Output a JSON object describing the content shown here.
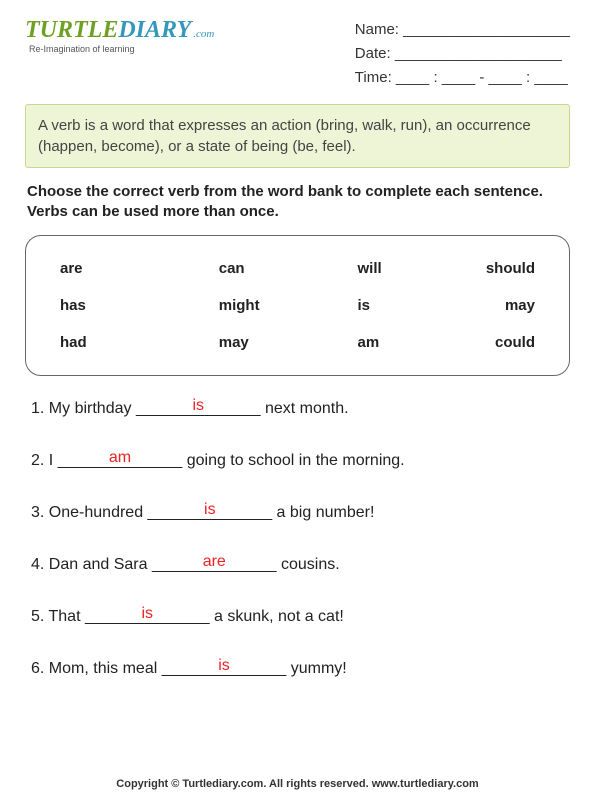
{
  "logo": {
    "part1": "TURTLE",
    "part2": "DIARY",
    "suffix": ".com",
    "tagline": "Re-Imagination of learning"
  },
  "info": {
    "name_label": "Name: ____________________",
    "date_label": "Date: ____________________",
    "time_label": "Time: ____ : ____ - ____ : ____"
  },
  "definition": "A verb is a word that expresses an action (bring, walk, run), an occurrence (happen, become), or a state of being (be, feel).",
  "instructions": "Choose the correct verb from the word bank to complete each sentence. Verbs can be used more than once.",
  "word_bank": [
    [
      "are",
      "can",
      "will",
      "should"
    ],
    [
      "has",
      "might",
      "is",
      "may"
    ],
    [
      "had",
      "may",
      "am",
      "could"
    ]
  ],
  "sentences": [
    {
      "n": "1.",
      "pre": "My birthday ",
      "blank": "______________",
      "answer": "is",
      "post": " next month."
    },
    {
      "n": "2.",
      "pre": "I ",
      "blank": "______________",
      "answer": "am",
      "post": " going to school in the morning."
    },
    {
      "n": "3.",
      "pre": "One-hundred ",
      "blank": "______________",
      "answer": "is",
      "post": " a big number!"
    },
    {
      "n": "4.",
      "pre": "Dan and Sara ",
      "blank": "______________",
      "answer": "are",
      "post": " cousins."
    },
    {
      "n": "5.",
      "pre": "That ",
      "blank": "______________",
      "answer": "is",
      "post": " a skunk, not a cat!"
    },
    {
      "n": "6.",
      "pre": "Mom, this meal ",
      "blank": "______________",
      "answer": "is",
      "post": " yummy!"
    }
  ],
  "footer": "Copyright © Turtlediary.com. All rights reserved. www.turtlediary.com"
}
